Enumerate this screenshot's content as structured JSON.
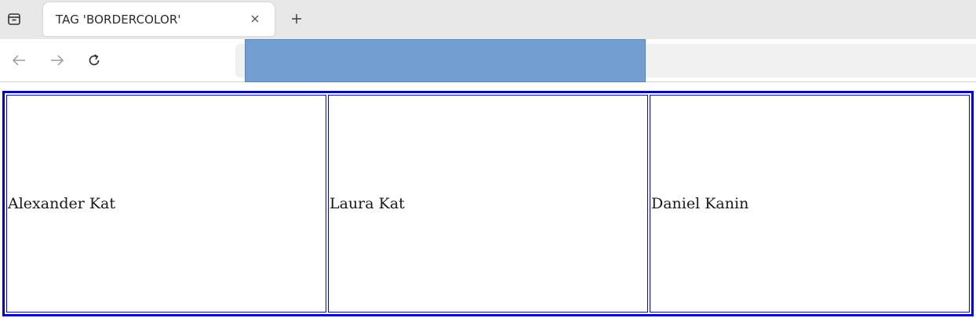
{
  "browser": {
    "tab_overview_icon": "tab-overview-icon",
    "active_tab": {
      "title": "TAG 'BORDERCOLOR'",
      "close_icon": "close-icon"
    },
    "new_tab_icon": "plus-icon",
    "nav": {
      "back_icon": "arrow-left-icon",
      "forward_icon": "arrow-right-icon",
      "reload_icon": "reload-icon"
    },
    "address_bar": {
      "value": "",
      "highlight_color": "#739fd0"
    }
  },
  "page": {
    "table": {
      "border_color": "#0000cc",
      "rows": [
        {
          "cells": [
            "Alexander Kat",
            "Laura Kat",
            "Daniel Kanin"
          ]
        }
      ]
    }
  }
}
